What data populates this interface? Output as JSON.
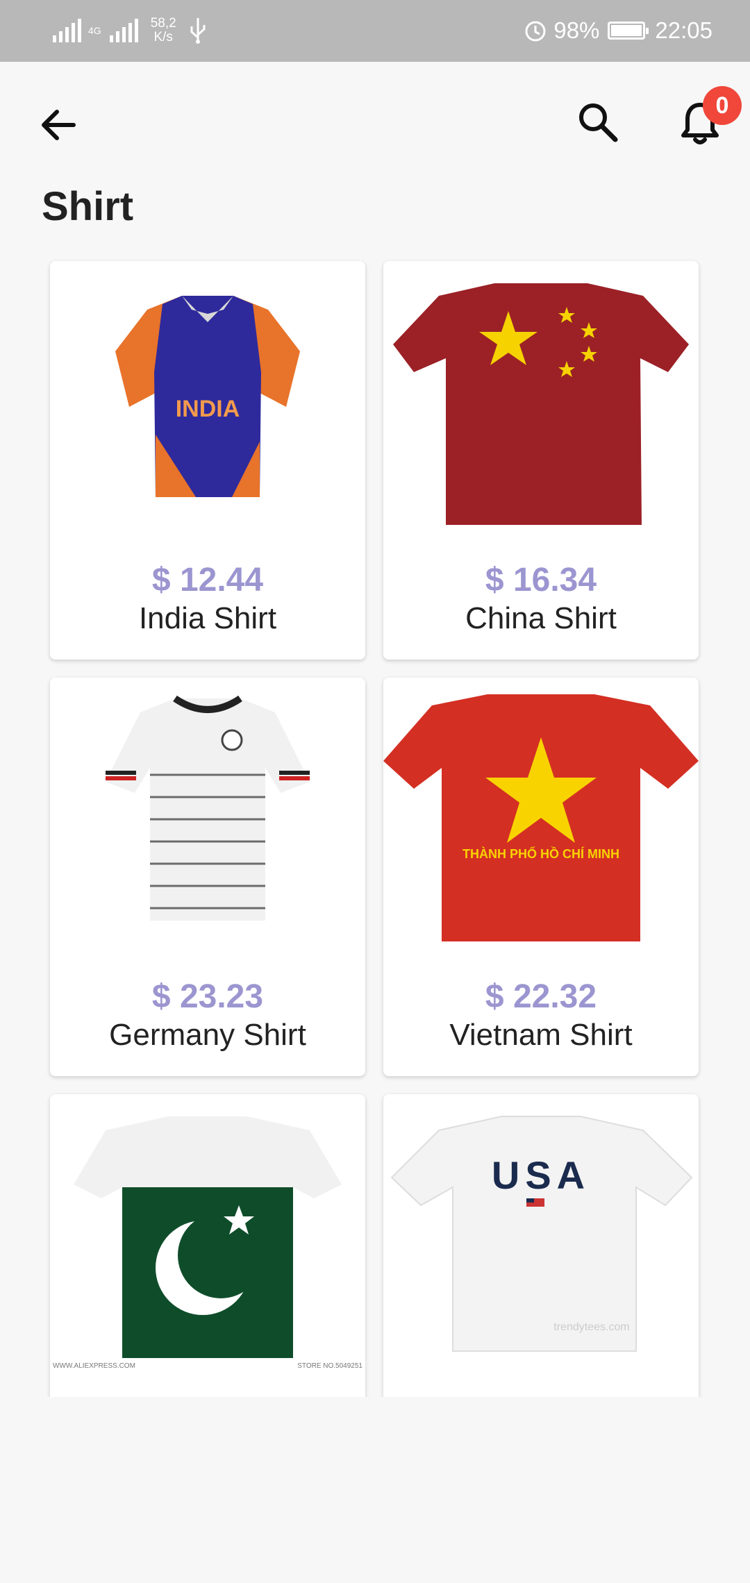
{
  "status_bar": {
    "net_speed_value": "58,2",
    "net_speed_unit": "K/s",
    "network_type": "4G",
    "battery": "98%",
    "time": "22:05"
  },
  "app_bar": {
    "notification_count": "0"
  },
  "page": {
    "title": "Shirt"
  },
  "products": [
    {
      "price": "$ 12.44",
      "name": "India Shirt",
      "print": "INDIA"
    },
    {
      "price": "$ 16.34",
      "name": "China Shirt"
    },
    {
      "price": "$ 23.23",
      "name": "Germany Shirt"
    },
    {
      "price": "$ 22.32",
      "name": "Vietnam Shirt",
      "print": "THÀNH PHỐ HỒ CHÍ MINH"
    },
    {
      "price": "",
      "name": "",
      "watermark_left": "WWW.ALIEXPRESS.COM",
      "watermark_right": "STORE NO.5049251"
    },
    {
      "price": "",
      "name": "",
      "print": "USA",
      "watermark": "trendytees.com"
    }
  ],
  "colors": {
    "price": "#9b95d0",
    "badge": "#f0473a",
    "status_bar": "#b8b8b8",
    "background": "#f7f7f7"
  }
}
